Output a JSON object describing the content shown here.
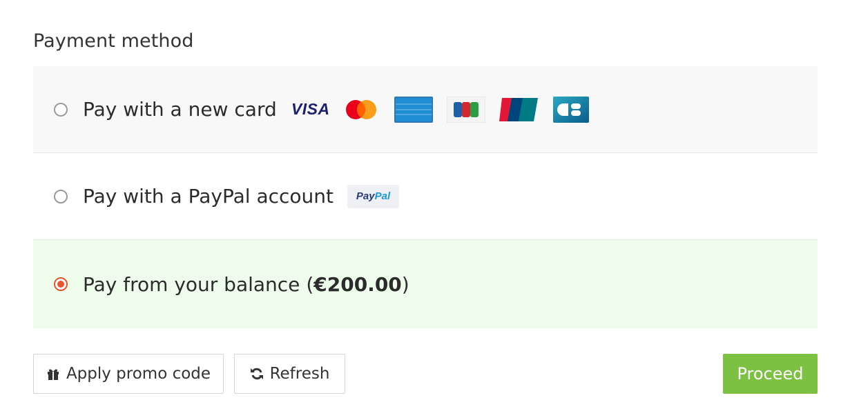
{
  "section_title": "Payment method",
  "options": [
    {
      "label": "Pay with a new card",
      "selected": false,
      "logos": [
        "visa",
        "mastercard",
        "american-express",
        "jcb",
        "unionpay",
        "cb"
      ]
    },
    {
      "label": "Pay with a PayPal account",
      "selected": false,
      "logos": [
        "paypal"
      ]
    },
    {
      "label_prefix": "Pay from your balance (",
      "amount": "€200.00",
      "label_suffix": ")",
      "selected": true
    }
  ],
  "logo_text": {
    "visa": "VISA",
    "paypal_pay": "Pay",
    "paypal_pal": "Pal"
  },
  "buttons": {
    "promo": "Apply promo code",
    "refresh": "Refresh",
    "proceed": "Proceed"
  },
  "colors": {
    "accent_selected": "#e8552d",
    "selected_row_bg": "#eefcec",
    "proceed_bg": "#7cc141"
  },
  "icons": {
    "promo": "gift-icon",
    "refresh": "refresh-icon"
  }
}
